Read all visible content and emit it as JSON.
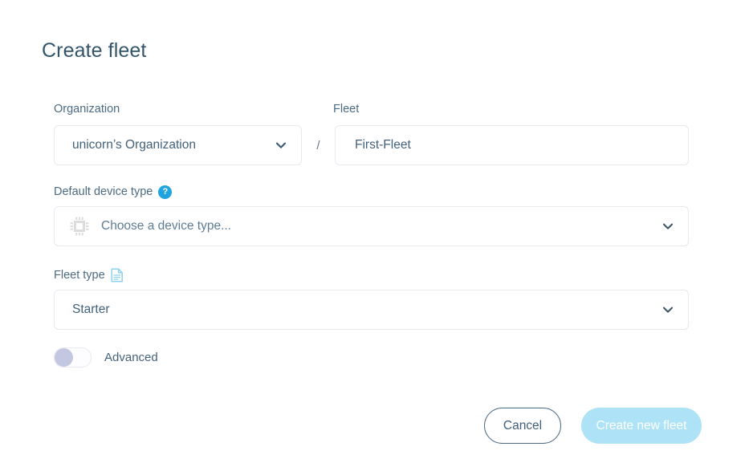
{
  "page": {
    "title": "Create fleet"
  },
  "form": {
    "organization": {
      "label": "Organization",
      "value": "unicorn’s Organization",
      "icon": "chevron-down-icon"
    },
    "separator": "/",
    "fleet": {
      "label": "Fleet",
      "value": "First-Fleet",
      "placeholder": "First-Fleet"
    },
    "default_device_type": {
      "label": "Default device type",
      "help_badge": "?",
      "help_icon": "question-circle-icon",
      "leading_icon": "cpu-chip-icon",
      "placeholder": "Choose a device type...",
      "value": "Choose a device type...",
      "icon": "chevron-down-icon"
    },
    "fleet_type": {
      "label": "Fleet type",
      "doc_icon": "document-icon",
      "value": "Starter",
      "icon": "chevron-down-icon"
    },
    "advanced": {
      "label": "Advanced",
      "state": "off"
    }
  },
  "footer": {
    "cancel_label": "Cancel",
    "create_label": "Create new fleet",
    "create_disabled": true
  },
  "colors": {
    "text_primary": "#34556b",
    "title": "#32556c",
    "border": "#e7e9ef",
    "help_badge_bg": "#20a4e0",
    "doc_icon": "#8ed2ef",
    "toggle_knob": "#c4c7e1",
    "primary_button_bg": "#aee3f7",
    "cancel_border": "#4b6b85",
    "chip_icon": "#dcdcdc"
  }
}
